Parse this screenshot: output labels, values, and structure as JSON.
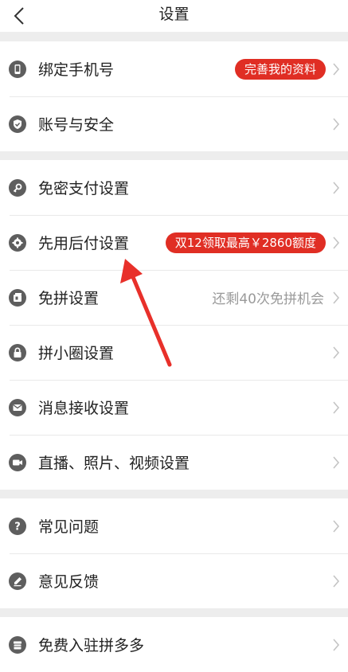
{
  "header": {
    "title": "设置"
  },
  "sections": [
    {
      "items": [
        {
          "label": "绑定手机号",
          "badge": "完善我的资料"
        },
        {
          "label": "账号与安全"
        }
      ]
    },
    {
      "items": [
        {
          "label": "免密支付设置"
        },
        {
          "label": "先用后付设置",
          "badge": "双12领取最高￥2860额度"
        },
        {
          "label": "免拼设置",
          "hint": "还剩40次免拼机会"
        },
        {
          "label": "拼小圈设置"
        },
        {
          "label": "消息接收设置"
        },
        {
          "label": "直播、照片、视频设置"
        }
      ]
    },
    {
      "items": [
        {
          "label": "常见问题"
        },
        {
          "label": "意见反馈"
        }
      ]
    },
    {
      "items": [
        {
          "label": "免费入驻拼多多"
        }
      ]
    }
  ],
  "colors": {
    "accent": "#e02e24",
    "annotation_arrow": "#e8302a"
  }
}
